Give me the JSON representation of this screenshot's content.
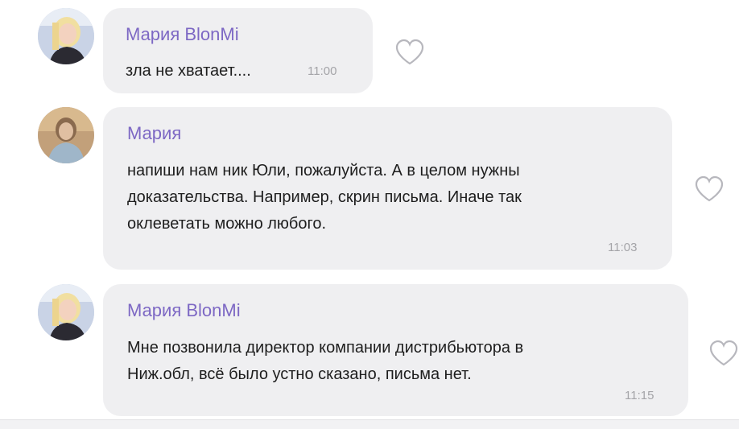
{
  "messages": [
    {
      "author": "Мария BlonMi",
      "text": "зла не хватает....",
      "time": "11:00",
      "avatar": "avatar-blonde-woman"
    },
    {
      "author": "Мария",
      "text": "напиши нам ник Юли, пожалуйста. А в целом нужны\nдоказательства. Например, скрин письма. Иначе так\nоклеветать можно любого.",
      "time": "11:03",
      "avatar": "avatar-woman-photo"
    },
    {
      "author": "Мария BlonMi",
      "text": "Мне позвонила директор компании дистрибьютора в\nНиж.обл, всё было устно сказано, письма нет.",
      "time": "11:15",
      "avatar": "avatar-blonde-woman"
    }
  ],
  "icons": {
    "like": "heart-outline-icon"
  },
  "colors": {
    "author": "#7d68c4",
    "bubble": "#efeff1",
    "time": "#a4a4a8",
    "text": "#1e1e1e"
  }
}
